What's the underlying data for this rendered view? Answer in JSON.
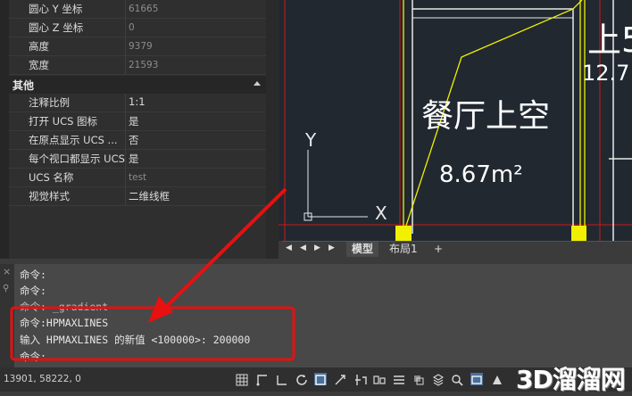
{
  "properties": {
    "rows_top": [
      {
        "label": "圆心 Y 坐标",
        "value": "61665"
      },
      {
        "label": "圆心 Z 坐标",
        "value": "0"
      },
      {
        "label": "高度",
        "value": "9379"
      },
      {
        "label": "宽度",
        "value": "21593"
      }
    ],
    "section_title": "其他",
    "rows_other": [
      {
        "label": "注释比例",
        "value": "1:1"
      },
      {
        "label": "打开 UCS 图标",
        "value": "是"
      },
      {
        "label": "在原点显示 UCS ...",
        "value": "否"
      },
      {
        "label": "每个视口都显示 UCS",
        "value": "是"
      },
      {
        "label": "UCS 名称",
        "value": "test"
      },
      {
        "label": "视觉样式",
        "value": "二维线框"
      }
    ]
  },
  "canvas": {
    "room_name": "餐厅上空",
    "room_area": "8.67m²",
    "right_label": "上5",
    "right_number": "12.7",
    "ucs_y": "Y",
    "ucs_x": "X",
    "colors": {
      "background": "#212830",
      "yellow": "#f0f000",
      "red": "#d01818",
      "white": "#ffffff"
    }
  },
  "layout_tabs": {
    "nav": [
      "◀",
      "◀",
      "▶",
      "▶"
    ],
    "tabs": [
      {
        "label": "模型",
        "active": true
      },
      {
        "label": "布局1",
        "active": false
      },
      {
        "label": "+",
        "active": false
      }
    ]
  },
  "command": {
    "close_glyph": "×",
    "lines": [
      {
        "text": "命令:"
      },
      {
        "text": "命令:"
      },
      {
        "text": "命令: _gradient"
      },
      {
        "text": "命令:HPMAXLINES"
      },
      {
        "text": "输入 HPMAXLINES 的新值 <100000>: 200000"
      },
      {
        "text": "命令:"
      }
    ]
  },
  "status": {
    "coords": "13901, 58222, 0",
    "icons": [
      "grid-icon",
      "snap-icon",
      "ortho-icon",
      "polar-icon",
      "osnap-icon",
      "otrack-icon",
      "ducs-icon",
      "dyn-icon",
      "lineweight-icon",
      "transparency-icon",
      "selection-cycling-icon",
      "3d-osnap-icon",
      "annotation-icon",
      "workspace-icon"
    ]
  },
  "watermark": "3D溜溜网"
}
